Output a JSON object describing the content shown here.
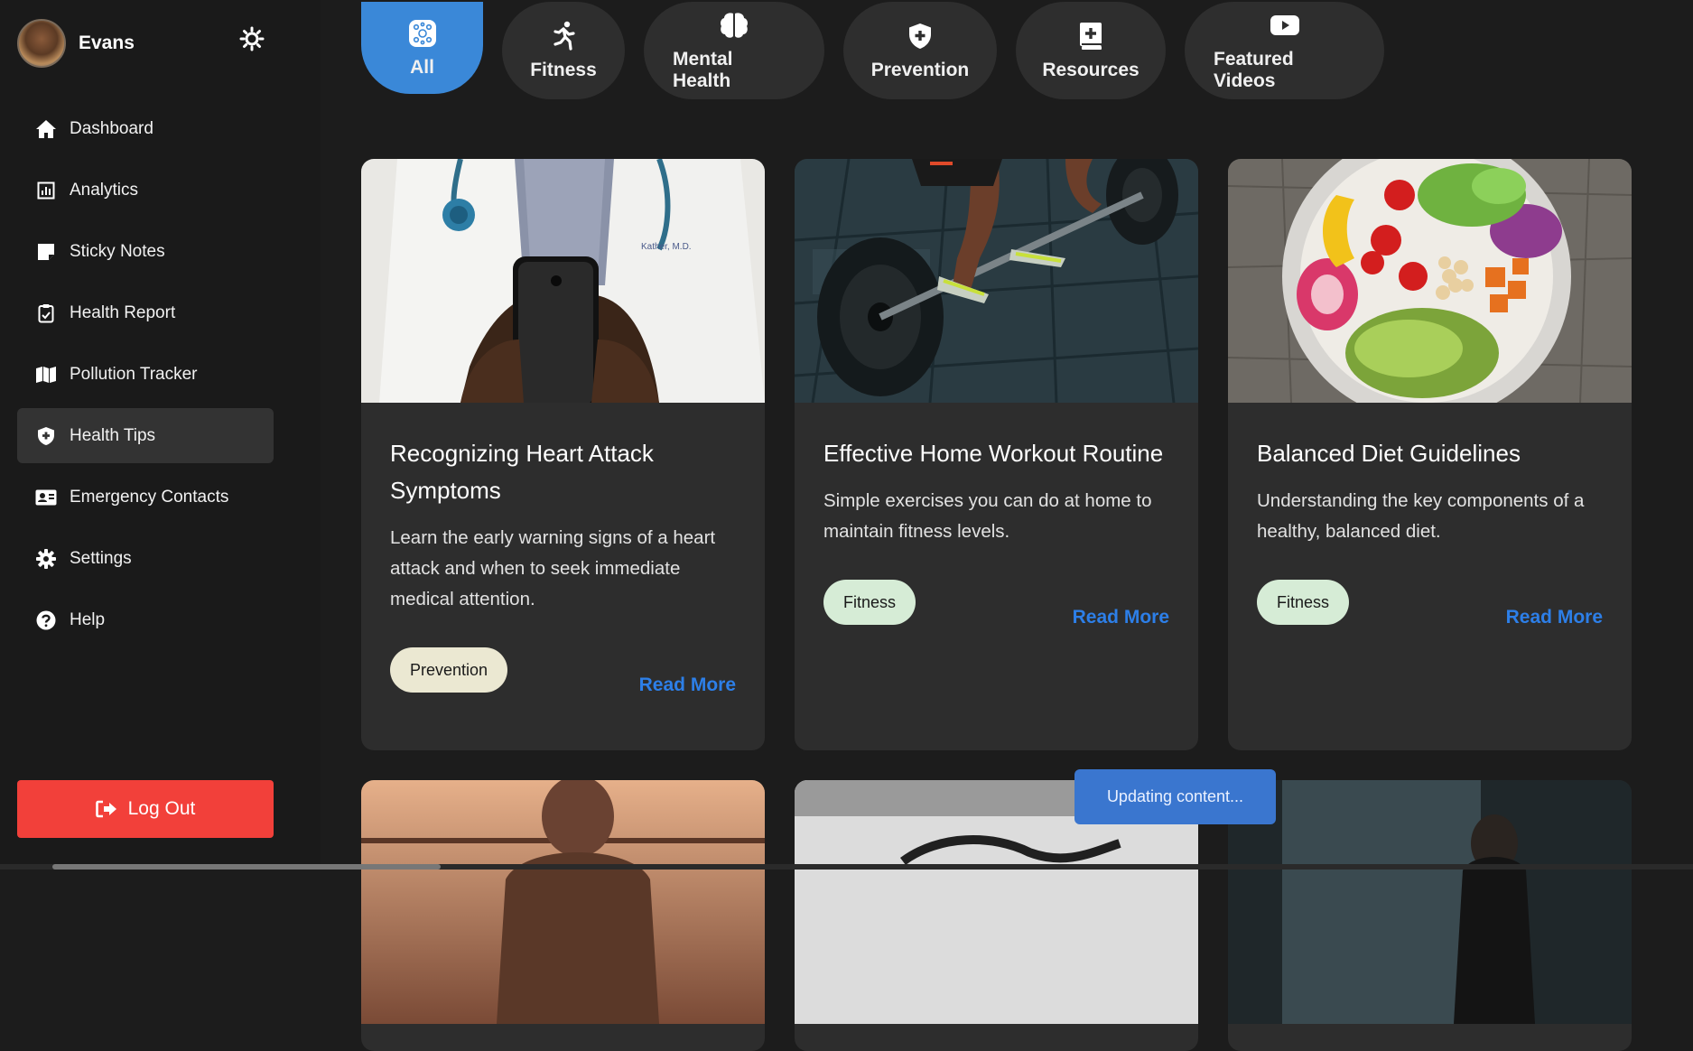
{
  "user": {
    "name": "Evans"
  },
  "sidebar": {
    "items": [
      {
        "label": "Dashboard",
        "icon": "home-icon"
      },
      {
        "label": "Analytics",
        "icon": "analytics-icon"
      },
      {
        "label": "Sticky Notes",
        "icon": "sticky-note-icon"
      },
      {
        "label": "Health Report",
        "icon": "clipboard-icon"
      },
      {
        "label": "Pollution Tracker",
        "icon": "map-icon"
      },
      {
        "label": "Health Tips",
        "icon": "shield-icon",
        "active": true
      },
      {
        "label": "Emergency Contacts",
        "icon": "contact-card-icon"
      },
      {
        "label": "Settings",
        "icon": "gear-icon"
      },
      {
        "label": "Help",
        "icon": "question-icon"
      }
    ],
    "logout_label": "Log Out"
  },
  "filters": [
    {
      "label": "All",
      "icon": "virus-icon",
      "active": true
    },
    {
      "label": "Fitness",
      "icon": "running-icon"
    },
    {
      "label": "Mental Health",
      "icon": "brain-icon"
    },
    {
      "label": "Prevention",
      "icon": "shield-plus-icon"
    },
    {
      "label": "Resources",
      "icon": "book-medical-icon"
    },
    {
      "label": "Featured Videos",
      "icon": "youtube-icon"
    }
  ],
  "cards": [
    {
      "title": "Recognizing Heart Attack Symptoms",
      "description": "Learn the early warning signs of a heart attack and when to seek immediate medical attention.",
      "tag": "Prevention",
      "read_more": "Read More"
    },
    {
      "title": "Effective Home Workout Routine",
      "description": "Simple exercises you can do at home to maintain fitness levels.",
      "tag": "Fitness",
      "read_more": "Read More"
    },
    {
      "title": "Balanced Diet Guidelines",
      "description": "Understanding the key components of a healthy, balanced diet.",
      "tag": "Fitness",
      "read_more": "Read More"
    }
  ],
  "toast": "Updating content...",
  "colors": {
    "accent": "#3a88d8",
    "link": "#2d7fe8",
    "logout": "#f2403a",
    "tag_prevention": "#ebe8d2",
    "tag_fitness": "#d6ecd6"
  }
}
